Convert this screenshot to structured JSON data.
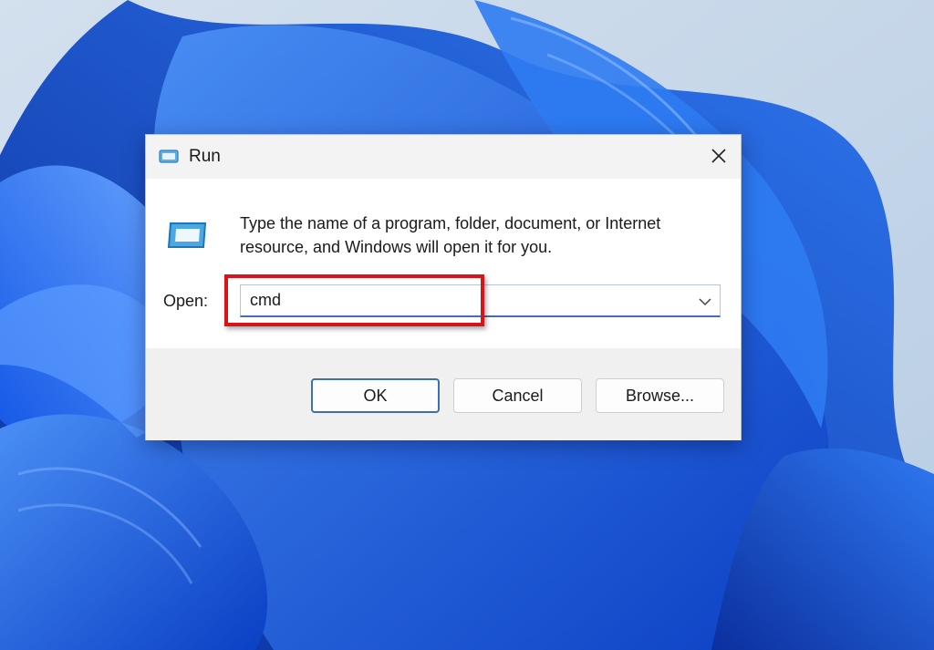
{
  "dialog": {
    "title": "Run",
    "description": "Type the name of a program, folder, document, or Internet resource, and Windows will open it for you.",
    "open_label": "Open:",
    "open_value": "cmd",
    "buttons": {
      "ok": "OK",
      "cancel": "Cancel",
      "browse": "Browse..."
    }
  },
  "icons": {
    "title": "run-app-icon",
    "close": "close-icon",
    "large": "run-app-large-icon",
    "dropdown": "chevron-down-icon"
  },
  "colors": {
    "highlight": "#d8141b",
    "accent": "#3d6fb3",
    "wallpaper_blue": "#1a5fe0"
  }
}
